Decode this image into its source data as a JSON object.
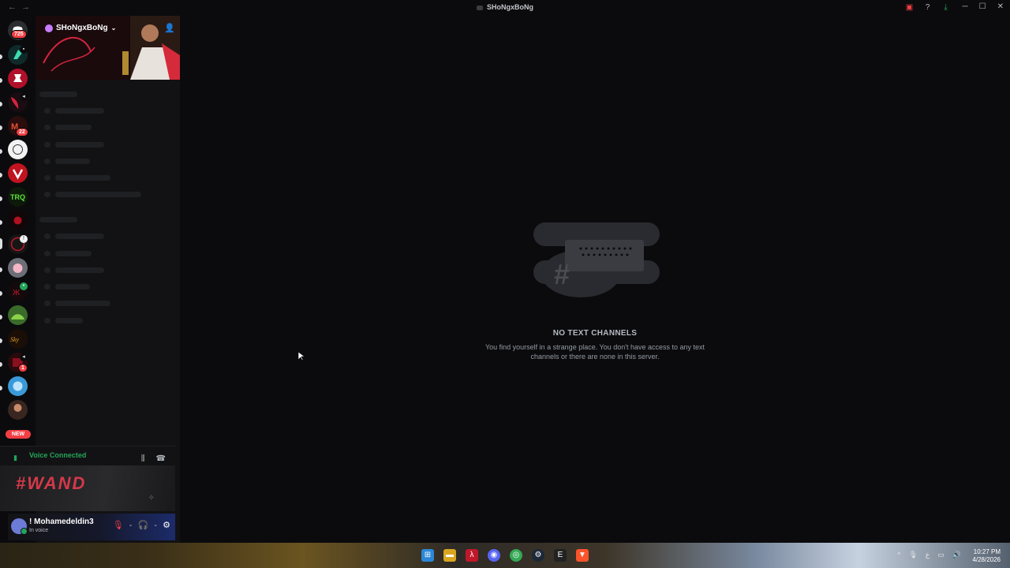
{
  "window": {
    "title": "SHoNgxBoNg",
    "nav_back": "←",
    "nav_forward": "→",
    "tools": [
      {
        "icon": "screen-share-icon",
        "glyph": "▣"
      },
      {
        "icon": "help-icon",
        "glyph": "?"
      },
      {
        "icon": "download-icon",
        "glyph": "⤓"
      }
    ],
    "controls": {
      "minimize": "─",
      "maximize": "☐",
      "close": "✕"
    }
  },
  "guilds": {
    "home_badge": "725",
    "mentions_badge": "22",
    "small_badge": "1",
    "new_label": "NEW"
  },
  "server": {
    "name": "SHoNgxBoNg",
    "chevron": "⌄",
    "invite_glyph": "👤"
  },
  "voice": {
    "status": "Voice Connected",
    "banner_text": "#WAND",
    "signal_glyph": "▮",
    "noise_glyph": "⫼",
    "disconnect_glyph": "☎",
    "sparkle_glyph": "✧"
  },
  "user": {
    "name": "! Mohamedeldin3",
    "status": "In voice",
    "mic_glyph": "🎙",
    "deafen_glyph": "🎧",
    "caret": "⌄",
    "settings_glyph": "⚙"
  },
  "main": {
    "empty_title": "NO TEXT CHANNELS",
    "empty_desc": "You find yourself in a strange place. You don't have access to any text channels or there are none in this server."
  },
  "taskbar": {
    "apps": [
      {
        "name": "windows",
        "glyph": "⊞",
        "color": "#2b88d8"
      },
      {
        "name": "file-explorer",
        "glyph": "▬",
        "color": "#f2c94c"
      },
      {
        "name": "app-red",
        "glyph": "λ",
        "color": "#c0182a"
      },
      {
        "name": "discord",
        "glyph": "◉",
        "color": "#5865f2"
      },
      {
        "name": "chrome",
        "glyph": "◎",
        "color": "#34a853"
      },
      {
        "name": "steam",
        "glyph": "⚙",
        "color": "#1b2838"
      },
      {
        "name": "epic",
        "glyph": "E",
        "color": "#222222"
      },
      {
        "name": "brave",
        "glyph": "▼",
        "color": "#fb542b"
      }
    ],
    "tray": [
      "^",
      "🎙",
      "ع",
      "▭",
      "🔊"
    ],
    "time": "10:27 PM",
    "date": "4/28/2026"
  }
}
